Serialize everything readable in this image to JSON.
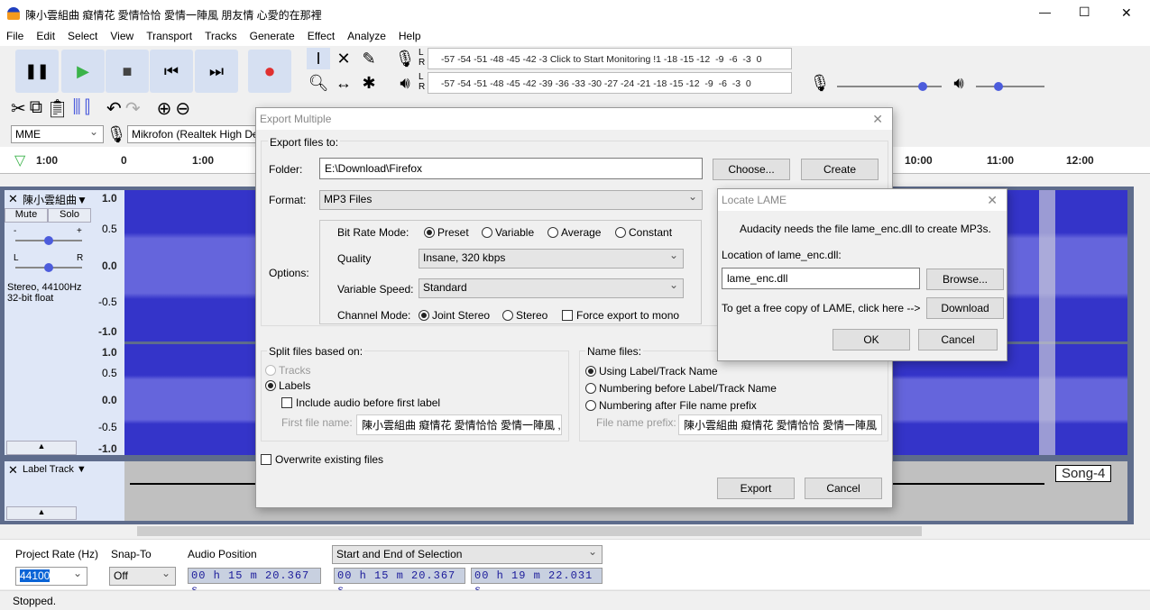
{
  "window": {
    "title": "陳小雲組曲  癡情花 愛情恰恰 愛情一陣風 朋友情 心愛的在那裡",
    "minimize": "—",
    "maximize": "☐",
    "close": "✕"
  },
  "menu": [
    "File",
    "Edit",
    "Select",
    "View",
    "Transport",
    "Tracks",
    "Generate",
    "Effect",
    "Analyze",
    "Help"
  ],
  "meters": {
    "record_scale": "-57 -54 -51 -48 -45 -42 -3",
    "record_prompt": "Click to Start Monitoring",
    "record_scale_end": "!1 -18 -15 -12  -9  -6  -3  0",
    "play_scale": "-57 -54 -51 -48 -45 -42 -39 -36 -33 -30 -27 -24 -21 -18 -15 -12  -9  -6  -3  0",
    "L": "L",
    "R": "R",
    "input_volume": 0.82,
    "output_volume": 0.33
  },
  "device": {
    "host": "MME",
    "input": "Mikrofon (Realtek High De"
  },
  "timeline": {
    "ticks_left": [
      "1:00",
      "0",
      "1:00"
    ],
    "ticks_right": [
      "10:00",
      "11:00",
      "12:00"
    ]
  },
  "track": {
    "name": "陳小雲組曲",
    "mute": "Mute",
    "solo": "Solo",
    "gain_minus": "-",
    "gain_plus": "+",
    "pan_l": "L",
    "pan_r": "R",
    "info1": "Stereo, 44100Hz",
    "info2": "32-bit float",
    "scale": [
      "1.0",
      "0.5",
      "0.0",
      "-0.5",
      "-1.0"
    ],
    "waveform_color": "#3434c9"
  },
  "label_track": {
    "name": "Label Track",
    "label": "Song-4"
  },
  "bottom": {
    "rate_label": "Project Rate (Hz)",
    "rate": "44100",
    "snap_label": "Snap-To",
    "snap": "Off",
    "pos_label": "Audio Position",
    "pos": "00 h 15 m 20.367 s",
    "sel_mode": "Start and End of Selection",
    "sel_start": "00 h 15 m 20.367 s",
    "sel_end": "00 h 19 m 22.031 s"
  },
  "status": "Stopped.",
  "export": {
    "title": "Export Multiple",
    "export_to": "Export files to:",
    "folder_label": "Folder:",
    "folder": "E:\\Download\\Firefox",
    "choose": "Choose...",
    "create": "Create",
    "format_label": "Format:",
    "format": "MP3 Files",
    "options_label": "Options:",
    "bitrate_label": "Bit Rate Mode:",
    "bitrate_modes": [
      "Preset",
      "Variable",
      "Average",
      "Constant"
    ],
    "quality_label": "Quality",
    "quality": "Insane, 320 kbps",
    "vspeed_label": "Variable Speed:",
    "vspeed": "Standard",
    "channel_label": "Channel Mode:",
    "channel_modes": [
      "Joint Stereo",
      "Stereo"
    ],
    "force_mono": "Force export to mono",
    "split_label": "Split files based on:",
    "tracks": "Tracks",
    "labels": "Labels",
    "include_audio": "Include audio before first label",
    "first_file_label": "First file name:",
    "first_file": "陳小雲組曲  癡情花 愛情恰恰 愛情一陣風 ,",
    "name_label": "Name files:",
    "name_opts": [
      "Using Label/Track Name",
      "Numbering before Label/Track Name",
      "Numbering after File name prefix"
    ],
    "prefix_label": "File name prefix:",
    "prefix": "陳小雲組曲  癡情花 愛情恰恰 愛情一陣風",
    "overwrite": "Overwrite existing files",
    "export_btn": "Export",
    "cancel_btn": "Cancel",
    "close": "✕"
  },
  "lame": {
    "title": "Locate LAME",
    "message": "Audacity needs the file lame_enc.dll to create MP3s.",
    "location_label": "Location of lame_enc.dll:",
    "location": "lame_enc.dll",
    "browse": "Browse...",
    "free_copy": "To get a free copy of LAME, click here -->",
    "download": "Download",
    "ok": "OK",
    "cancel": "Cancel",
    "close": "✕"
  }
}
